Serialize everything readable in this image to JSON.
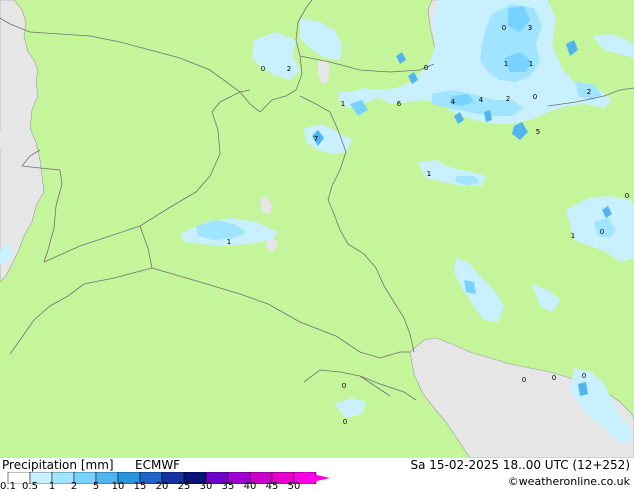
{
  "footer": {
    "title": "Precipitation [mm]",
    "model": "ECMWF",
    "valid_time": "Sa 15-02-2025 18..00 UTC (12+252)",
    "credit": "©weatheronline.co.uk"
  },
  "legend": {
    "ticks": [
      "0.1",
      "0.5",
      "1",
      "2",
      "5",
      "10",
      "15",
      "20",
      "25",
      "30",
      "35",
      "40",
      "45",
      "50"
    ],
    "colors": [
      "#ffffff",
      "#c8f0ff",
      "#a0e4ff",
      "#78d2ff",
      "#50b4f0",
      "#2896dc",
      "#1e64c8",
      "#1432a0",
      "#0a1478",
      "#6e00c8",
      "#a000d2",
      "#c800c8",
      "#e600c8",
      "#ff00e6"
    ]
  },
  "map": {
    "land_color": "#c4f59a",
    "water_color": "#e6e6e6",
    "border_color": "#707070",
    "precip_light": "#c8f0ff",
    "precip_mid": "#a0e4ff",
    "precip_strong": "#78d2ff",
    "precip_heavy": "#50b4f0",
    "labels": [
      "0",
      "2",
      "1",
      "6",
      "0",
      "1",
      "1",
      "3",
      "0",
      "4",
      "4",
      "2",
      "0",
      "2",
      "5",
      "7",
      "1",
      "1",
      "1",
      "0",
      "0",
      "0",
      "0",
      "0",
      "0",
      "0"
    ]
  }
}
